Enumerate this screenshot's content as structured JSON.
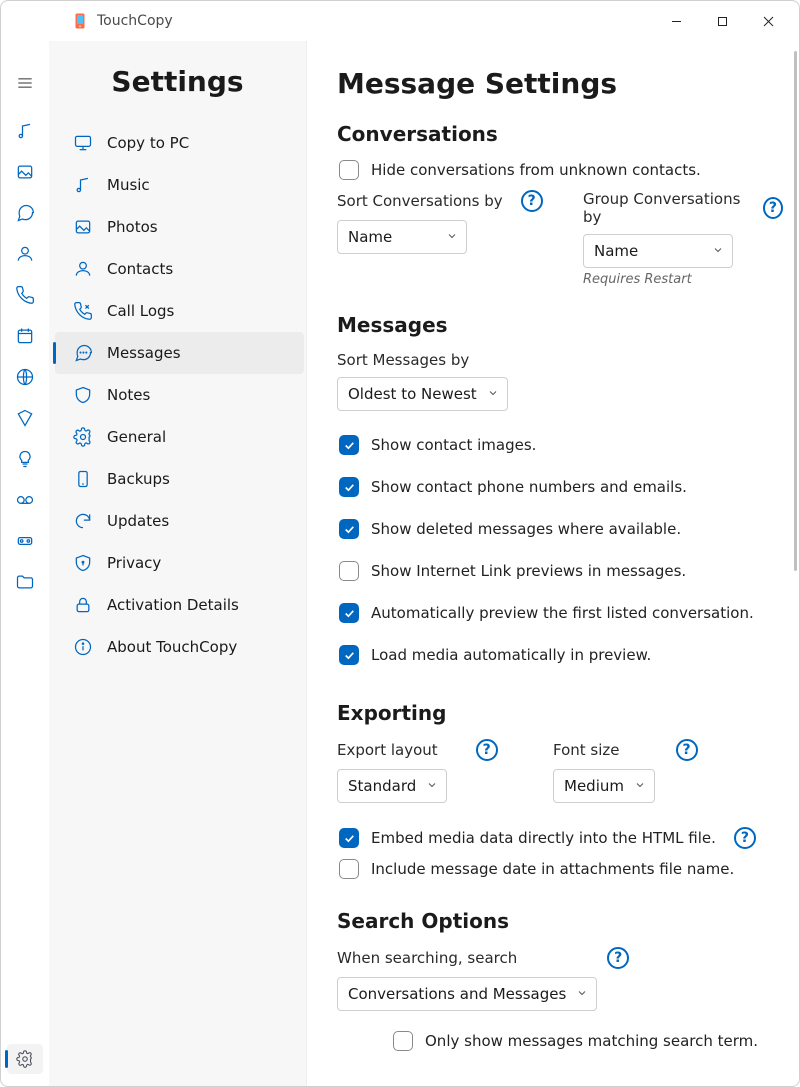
{
  "titlebar": {
    "app_name": "TouchCopy"
  },
  "sidebar": {
    "title": "Settings",
    "items": [
      {
        "label": "Copy to PC"
      },
      {
        "label": "Music"
      },
      {
        "label": "Photos"
      },
      {
        "label": "Contacts"
      },
      {
        "label": "Call Logs"
      },
      {
        "label": "Messages"
      },
      {
        "label": "Notes"
      },
      {
        "label": "General"
      },
      {
        "label": "Backups"
      },
      {
        "label": "Updates"
      },
      {
        "label": "Privacy"
      },
      {
        "label": "Activation Details"
      },
      {
        "label": "About TouchCopy"
      }
    ]
  },
  "page": {
    "title": "Message Settings",
    "sections": {
      "conversations": {
        "title": "Conversations",
        "hide_unknown": "Hide conversations from unknown contacts.",
        "sort_label": "Sort Conversations by",
        "sort_value": "Name",
        "group_label": "Group Conversations by",
        "group_value": "Name",
        "group_hint": "Requires Restart"
      },
      "messages": {
        "title": "Messages",
        "sort_label": "Sort Messages by",
        "sort_value": "Oldest to Newest",
        "cb1": "Show contact images.",
        "cb2": "Show contact phone numbers and emails.",
        "cb3": "Show deleted messages where available.",
        "cb4": "Show Internet Link previews in messages.",
        "cb5": "Automatically preview the first listed conversation.",
        "cb6": "Load media automatically in preview."
      },
      "exporting": {
        "title": "Exporting",
        "layout_label": "Export layout",
        "layout_value": "Standard",
        "font_label": "Font size",
        "font_value": "Medium",
        "cb_embed": "Embed media data directly into the HTML file.",
        "cb_date": "Include message date in attachments file name."
      },
      "search": {
        "title": "Search Options",
        "when_label": "When searching, search",
        "when_value": "Conversations and Messages",
        "cb_only": "Only show messages matching search term."
      }
    }
  }
}
